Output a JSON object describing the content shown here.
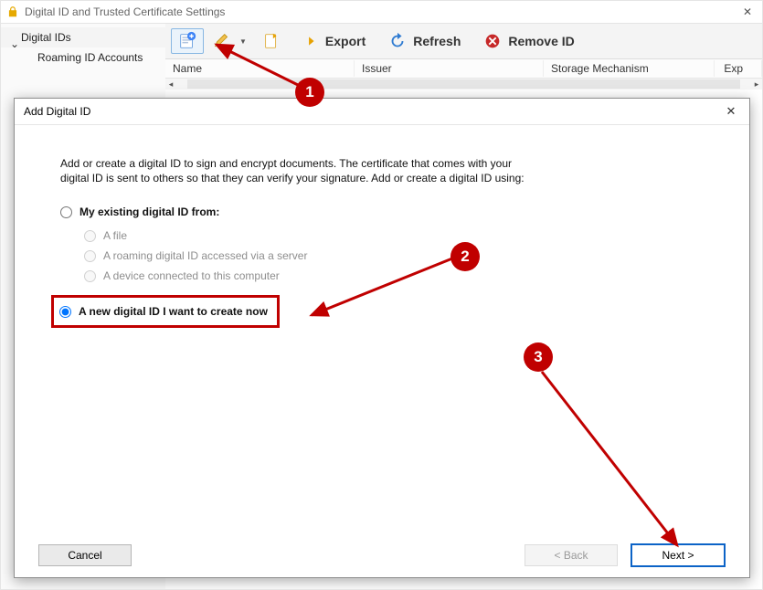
{
  "main": {
    "title": "Digital ID and Trusted Certificate Settings",
    "side": {
      "digital_ids": "Digital IDs",
      "roaming": "Roaming ID Accounts"
    },
    "toolbar": {
      "new_tip": "Add ID",
      "edit_tip": "Edit",
      "options_tip": "Options",
      "export": "Export",
      "refresh": "Refresh",
      "remove": "Remove ID"
    },
    "headers": {
      "name": "Name",
      "issuer": "Issuer",
      "storage": "Storage Mechanism",
      "expires": "Exp"
    }
  },
  "dialog": {
    "title": "Add Digital ID",
    "intro": "Add or create a digital ID to sign and encrypt documents. The certificate that comes with your digital ID is sent to others so that they can verify your signature. Add or create a digital ID using:",
    "opt_existing": "My existing digital ID from:",
    "opt_file": "A file",
    "opt_roaming": "A roaming digital ID accessed via a server",
    "opt_device": "A device connected to this computer",
    "opt_new": "A new digital ID I want to create now",
    "cancel": "Cancel",
    "back": "< Back",
    "next": "Next >"
  },
  "steps": {
    "s1": "1",
    "s2": "2",
    "s3": "3"
  }
}
